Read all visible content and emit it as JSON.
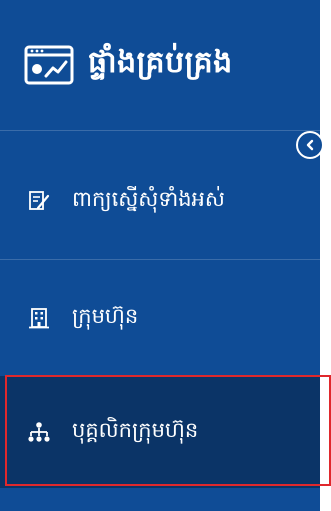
{
  "sidebar": {
    "title": "ផ្ទាំងគ្រប់គ្រង",
    "items": [
      {
        "label": "ពាក្យស្នើសុំទាំងអស់",
        "icon": "edit-document-icon",
        "active": false
      },
      {
        "label": "ក្រុមហ៊ុន",
        "icon": "building-icon",
        "active": false
      },
      {
        "label": "បុគ្គលិកក្រុមហ៊ុន",
        "icon": "org-chart-icon",
        "active": true
      }
    ]
  },
  "colors": {
    "sidebar_bg": "#0f4c96",
    "active_bg": "#0b3467",
    "highlight_border": "#e0282c",
    "text": "#ffffff"
  }
}
